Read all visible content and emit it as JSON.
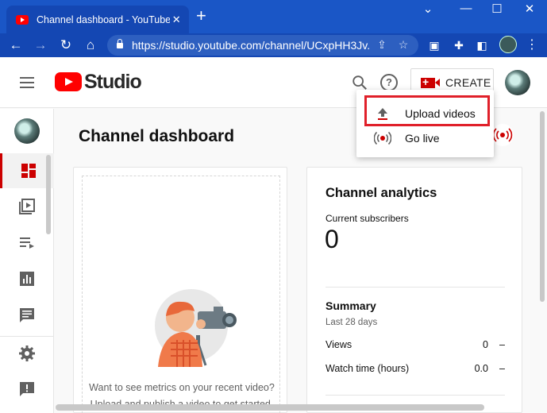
{
  "browser": {
    "tab_title": "Channel dashboard - YouTube Studio",
    "tab_close": "✕",
    "new_tab": "+",
    "url": "https://studio.youtube.com/channel/UCxpHH3Jv...",
    "window_controls": [
      "⌄",
      "—",
      "☐",
      "✕"
    ]
  },
  "header": {
    "logo_text": "Studio",
    "help_glyph": "?",
    "create_label": "CREATE"
  },
  "create_menu": {
    "items": [
      {
        "label": "Upload videos",
        "icon": "upload-icon"
      },
      {
        "label": "Go live",
        "icon": "live-icon"
      }
    ]
  },
  "main": {
    "title": "Channel dashboard",
    "empty_state": {
      "line1": "Want to see metrics on your recent video?",
      "line2": "Upload and publish a video to get started."
    }
  },
  "analytics": {
    "title": "Channel analytics",
    "subscribers_label": "Current subscribers",
    "subscribers_value": "0",
    "summary_title": "Summary",
    "summary_period": "Last 28 days",
    "metrics": [
      {
        "label": "Views",
        "value": "0",
        "trend": "–"
      },
      {
        "label": "Watch time (hours)",
        "value": "0.0",
        "trend": "–"
      }
    ]
  },
  "colors": {
    "chrome_blue": "#1a56c6",
    "youtube_red": "#ff0000",
    "highlight_red": "#e0202a",
    "active_nav_red": "#cc0000"
  }
}
